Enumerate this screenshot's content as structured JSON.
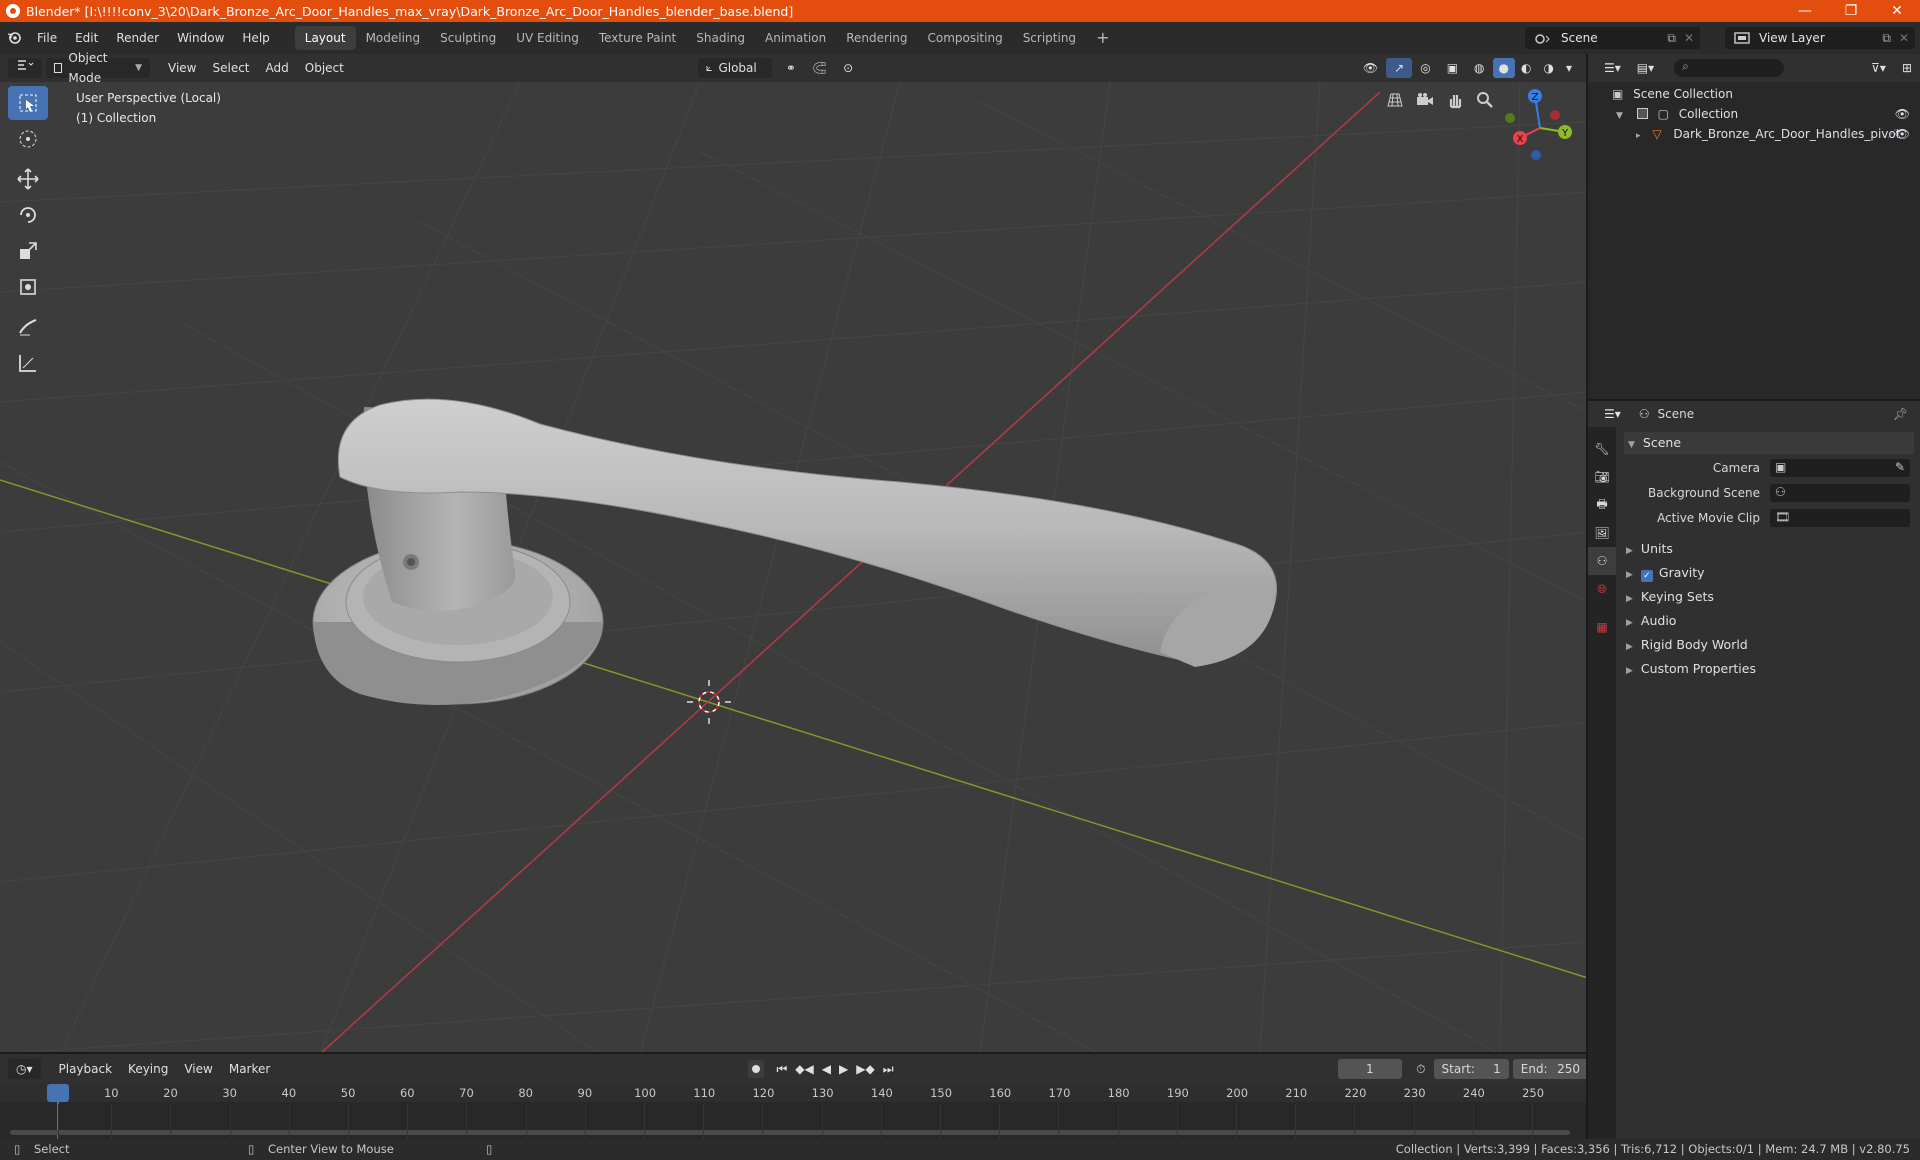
{
  "titlebar": {
    "title": "Blender* [I:\\!!!!conv_3\\20\\Dark_Bronze_Arc_Door_Handles_max_vray\\Dark_Bronze_Arc_Door_Handles_blender_base.blend]",
    "minimize": "—",
    "maximize": "❐",
    "close": "✕"
  },
  "menubar": {
    "menus": [
      "File",
      "Edit",
      "Render",
      "Window",
      "Help"
    ],
    "workspaces": [
      "Layout",
      "Modeling",
      "Sculpting",
      "UV Editing",
      "Texture Paint",
      "Shading",
      "Animation",
      "Rendering",
      "Compositing",
      "Scripting"
    ],
    "add_tab": "+",
    "scene": "Scene",
    "view_layer": "View Layer"
  },
  "viewport_header": {
    "mode": "Object Mode",
    "menus": [
      "View",
      "Select",
      "Add",
      "Object"
    ],
    "orientation": "Global"
  },
  "viewport": {
    "perspective": "User Perspective (Local)",
    "collection": "(1) Collection",
    "gizmo": {
      "x": "X",
      "y": "Y",
      "z": "Z"
    }
  },
  "outliner": {
    "root": "Scene Collection",
    "collection": "Collection",
    "object": "Dark_Bronze_Arc_Door_Handles_pivot"
  },
  "properties": {
    "header": "Scene",
    "section": "Scene",
    "fields": [
      {
        "label": "Camera",
        "value": ""
      },
      {
        "label": "Background Scene",
        "value": ""
      },
      {
        "label": "Active Movie Clip",
        "value": ""
      }
    ],
    "subsections": [
      "Units",
      "Gravity",
      "Keying Sets",
      "Audio",
      "Rigid Body World",
      "Custom Properties"
    ],
    "gravity_checked": true
  },
  "timeline": {
    "menus": [
      "Playback",
      "Keying",
      "View",
      "Marker"
    ],
    "current_frame": "1",
    "start_label": "Start:",
    "start": "1",
    "end_label": "End:",
    "end": "250",
    "ticks": [
      "1",
      "10",
      "20",
      "30",
      "40",
      "50",
      "60",
      "70",
      "80",
      "90",
      "100",
      "110",
      "120",
      "130",
      "140",
      "150",
      "160",
      "170",
      "180",
      "190",
      "200",
      "210",
      "220",
      "230",
      "240",
      "250"
    ]
  },
  "statusbar": {
    "left": "Select",
    "middle": "Center View to Mouse",
    "right": "Collection | Verts:3,399 | Faces:3,356 | Tris:6,712 | Objects:0/1 | Mem: 24.7 MB | v2.80.75"
  },
  "colors": {
    "accent": "#4772b3",
    "titlebar": "#e34d0e",
    "x_axis": "#e8424f",
    "y_axis": "#8cba2a",
    "z_axis": "#3a7ee0"
  }
}
